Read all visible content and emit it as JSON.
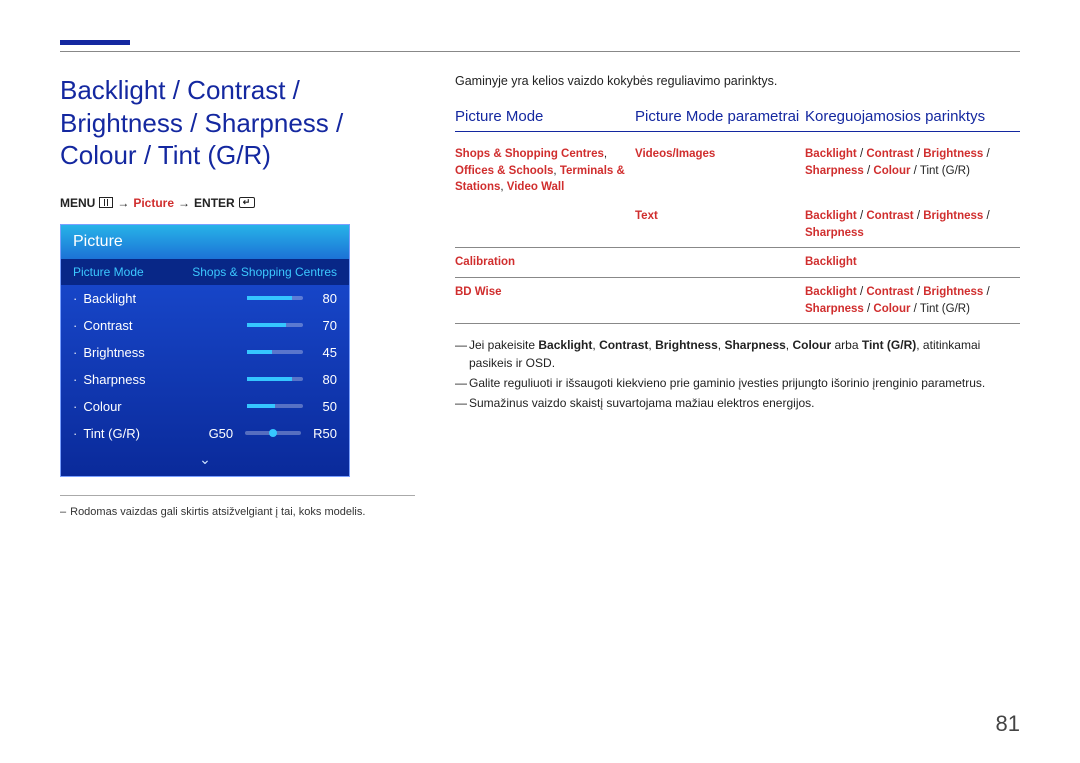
{
  "page_number": "81",
  "page_title": "Backlight / Contrast / Brightness / Sharpness / Colour / Tint (G/R)",
  "breadcrumb": {
    "menu": "MENU",
    "arrow": "→",
    "picture": "Picture",
    "enter": "ENTER"
  },
  "osd": {
    "header": "Picture",
    "mode_label": "Picture Mode",
    "mode_value": "Shops & Shopping Centres",
    "rows": [
      {
        "name": "Backlight",
        "value": "80",
        "pct": 80
      },
      {
        "name": "Contrast",
        "value": "70",
        "pct": 70
      },
      {
        "name": "Brightness",
        "value": "45",
        "pct": 45
      },
      {
        "name": "Sharpness",
        "value": "80",
        "pct": 80
      },
      {
        "name": "Colour",
        "value": "50",
        "pct": 50
      }
    ],
    "tint": {
      "name": "Tint (G/R)",
      "g": "G50",
      "r": "R50"
    }
  },
  "left_footnote": "Rodomas vaizdas gali skirtis atsižvelgiant į tai, koks modelis.",
  "intro": "Gaminyje yra kelios vaizdo kokybės reguliavimo parinktys.",
  "table": {
    "headers": {
      "c1": "Picture Mode",
      "c2": "Picture Mode parametrai",
      "c3": "Koreguojamosios parinktys"
    },
    "rows": [
      {
        "c1": "Shops & Shopping Centres, Offices & Schools, Terminals & Stations, Video Wall",
        "sub": [
          {
            "c2": "Videos/Images",
            "c3_parts": [
              "Backlight",
              " / ",
              "Contrast",
              " / ",
              "Brightness",
              " / ",
              "Sharpness",
              " / ",
              "Colour",
              " / ",
              "Tint (G/R)"
            ]
          },
          {
            "c2": "Text",
            "c3_parts": [
              "Backlight",
              " / ",
              "Contrast",
              " / ",
              "Brightness",
              " / ",
              "Sharpness"
            ]
          }
        ]
      },
      {
        "c1": "Calibration",
        "sub": [
          {
            "c2": "",
            "c3_parts": [
              "Backlight"
            ]
          }
        ]
      },
      {
        "c1": "BD Wise",
        "sub": [
          {
            "c2": "",
            "c3_parts": [
              "Backlight",
              " / ",
              "Contrast",
              " / ",
              "Brightness",
              " / ",
              "Sharpness",
              " / ",
              "Colour",
              " / ",
              "Tint (G/R)"
            ]
          }
        ]
      }
    ]
  },
  "notes": {
    "n1_pre": "Jei pakeisite ",
    "n1_b": [
      "Backlight",
      "Contrast",
      "Brightness",
      "Sharpness",
      "Colour"
    ],
    "n1_arba": " arba ",
    "n1_tint": "Tint (G/R)",
    "n1_post": ", atitinkamai pasikeis ir OSD.",
    "n2": "Galite reguliuoti ir išsaugoti kiekvieno prie gaminio įvesties prijungto išorinio įrenginio parametrus.",
    "n3": "Sumažinus vaizdo skaistį suvartojama mažiau elektros energijos."
  }
}
